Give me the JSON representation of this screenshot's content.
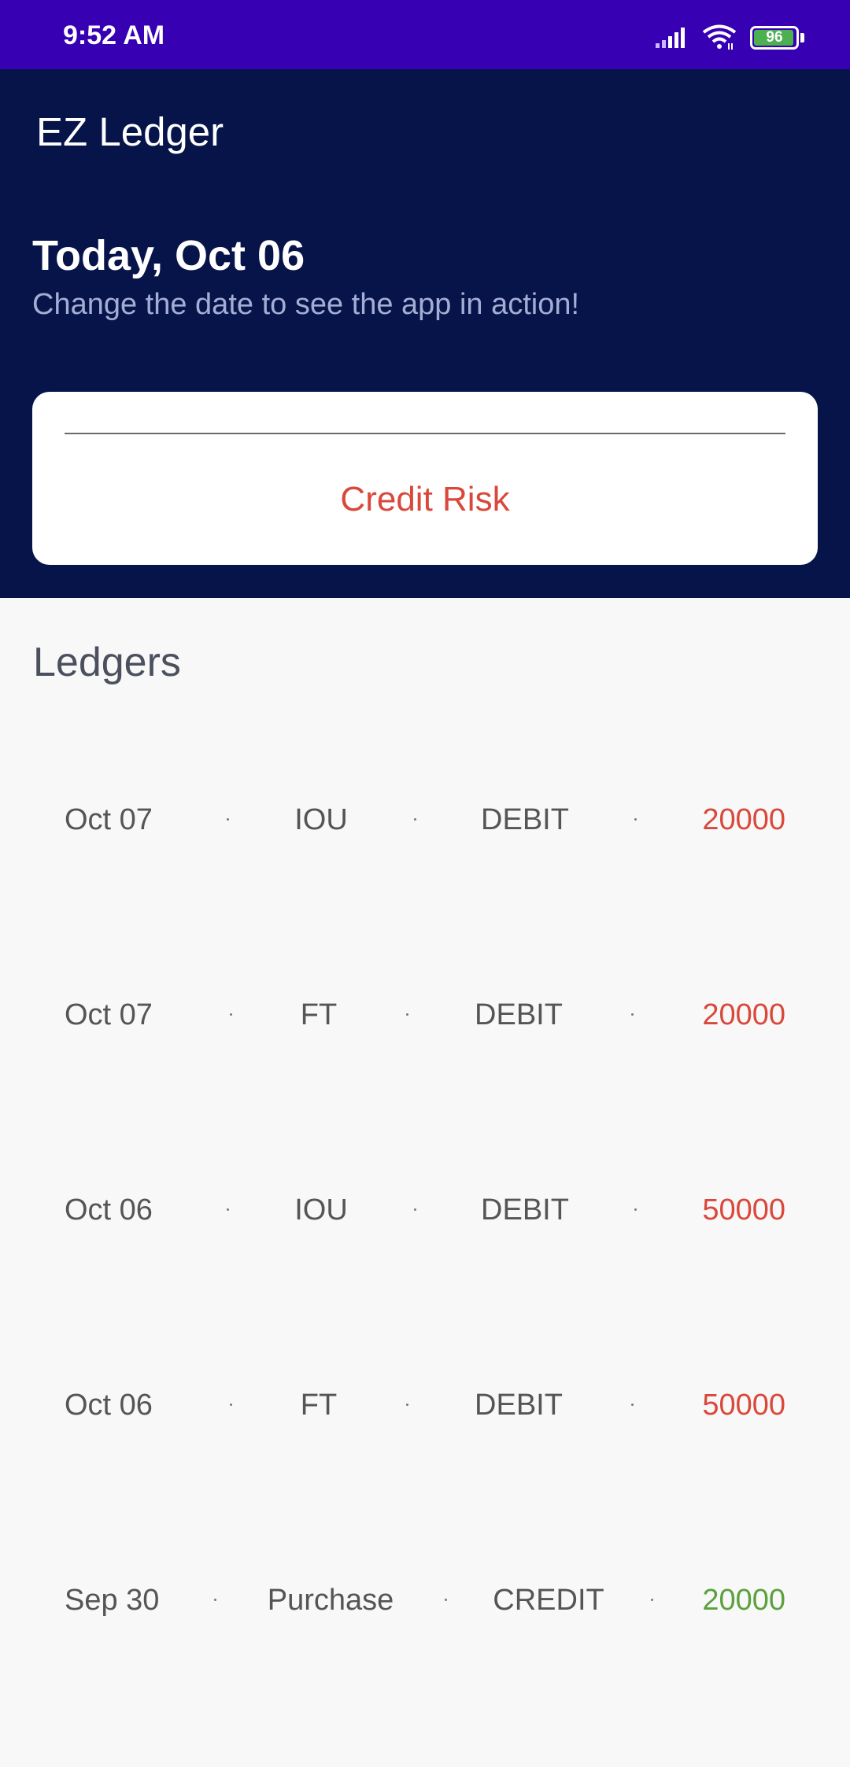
{
  "status_bar": {
    "time": "9:52 AM",
    "battery_level": 96,
    "battery_text": "96",
    "signal_icon": "signal-icon",
    "wifi_icon": "wifi-icon",
    "battery_icon": "battery-icon"
  },
  "header": {
    "app_title": "EZ Ledger",
    "date_title": "Today, Oct 06",
    "date_subtitle": "Change the date to see the app in action!"
  },
  "risk_card": {
    "input_value": "",
    "label": "Credit Risk",
    "label_color": "#d9483b"
  },
  "ledgers": {
    "title": "Ledgers",
    "rows": [
      {
        "date": "Oct 07",
        "type": "IOU",
        "kind": "DEBIT",
        "amount": "20000"
      },
      {
        "date": "Oct 07",
        "type": "FT",
        "kind": "DEBIT",
        "amount": "20000"
      },
      {
        "date": "Oct 06",
        "type": "IOU",
        "kind": "DEBIT",
        "amount": "50000"
      },
      {
        "date": "Oct 06",
        "type": "FT",
        "kind": "DEBIT",
        "amount": "50000"
      },
      {
        "date": "Sep 30",
        "type": "Purchase",
        "kind": "CREDIT",
        "amount": "20000"
      }
    ]
  },
  "colors": {
    "status_bar": "#3700b3",
    "header": "#06144a",
    "debit": "#d9483b",
    "credit": "#5aa13c"
  }
}
